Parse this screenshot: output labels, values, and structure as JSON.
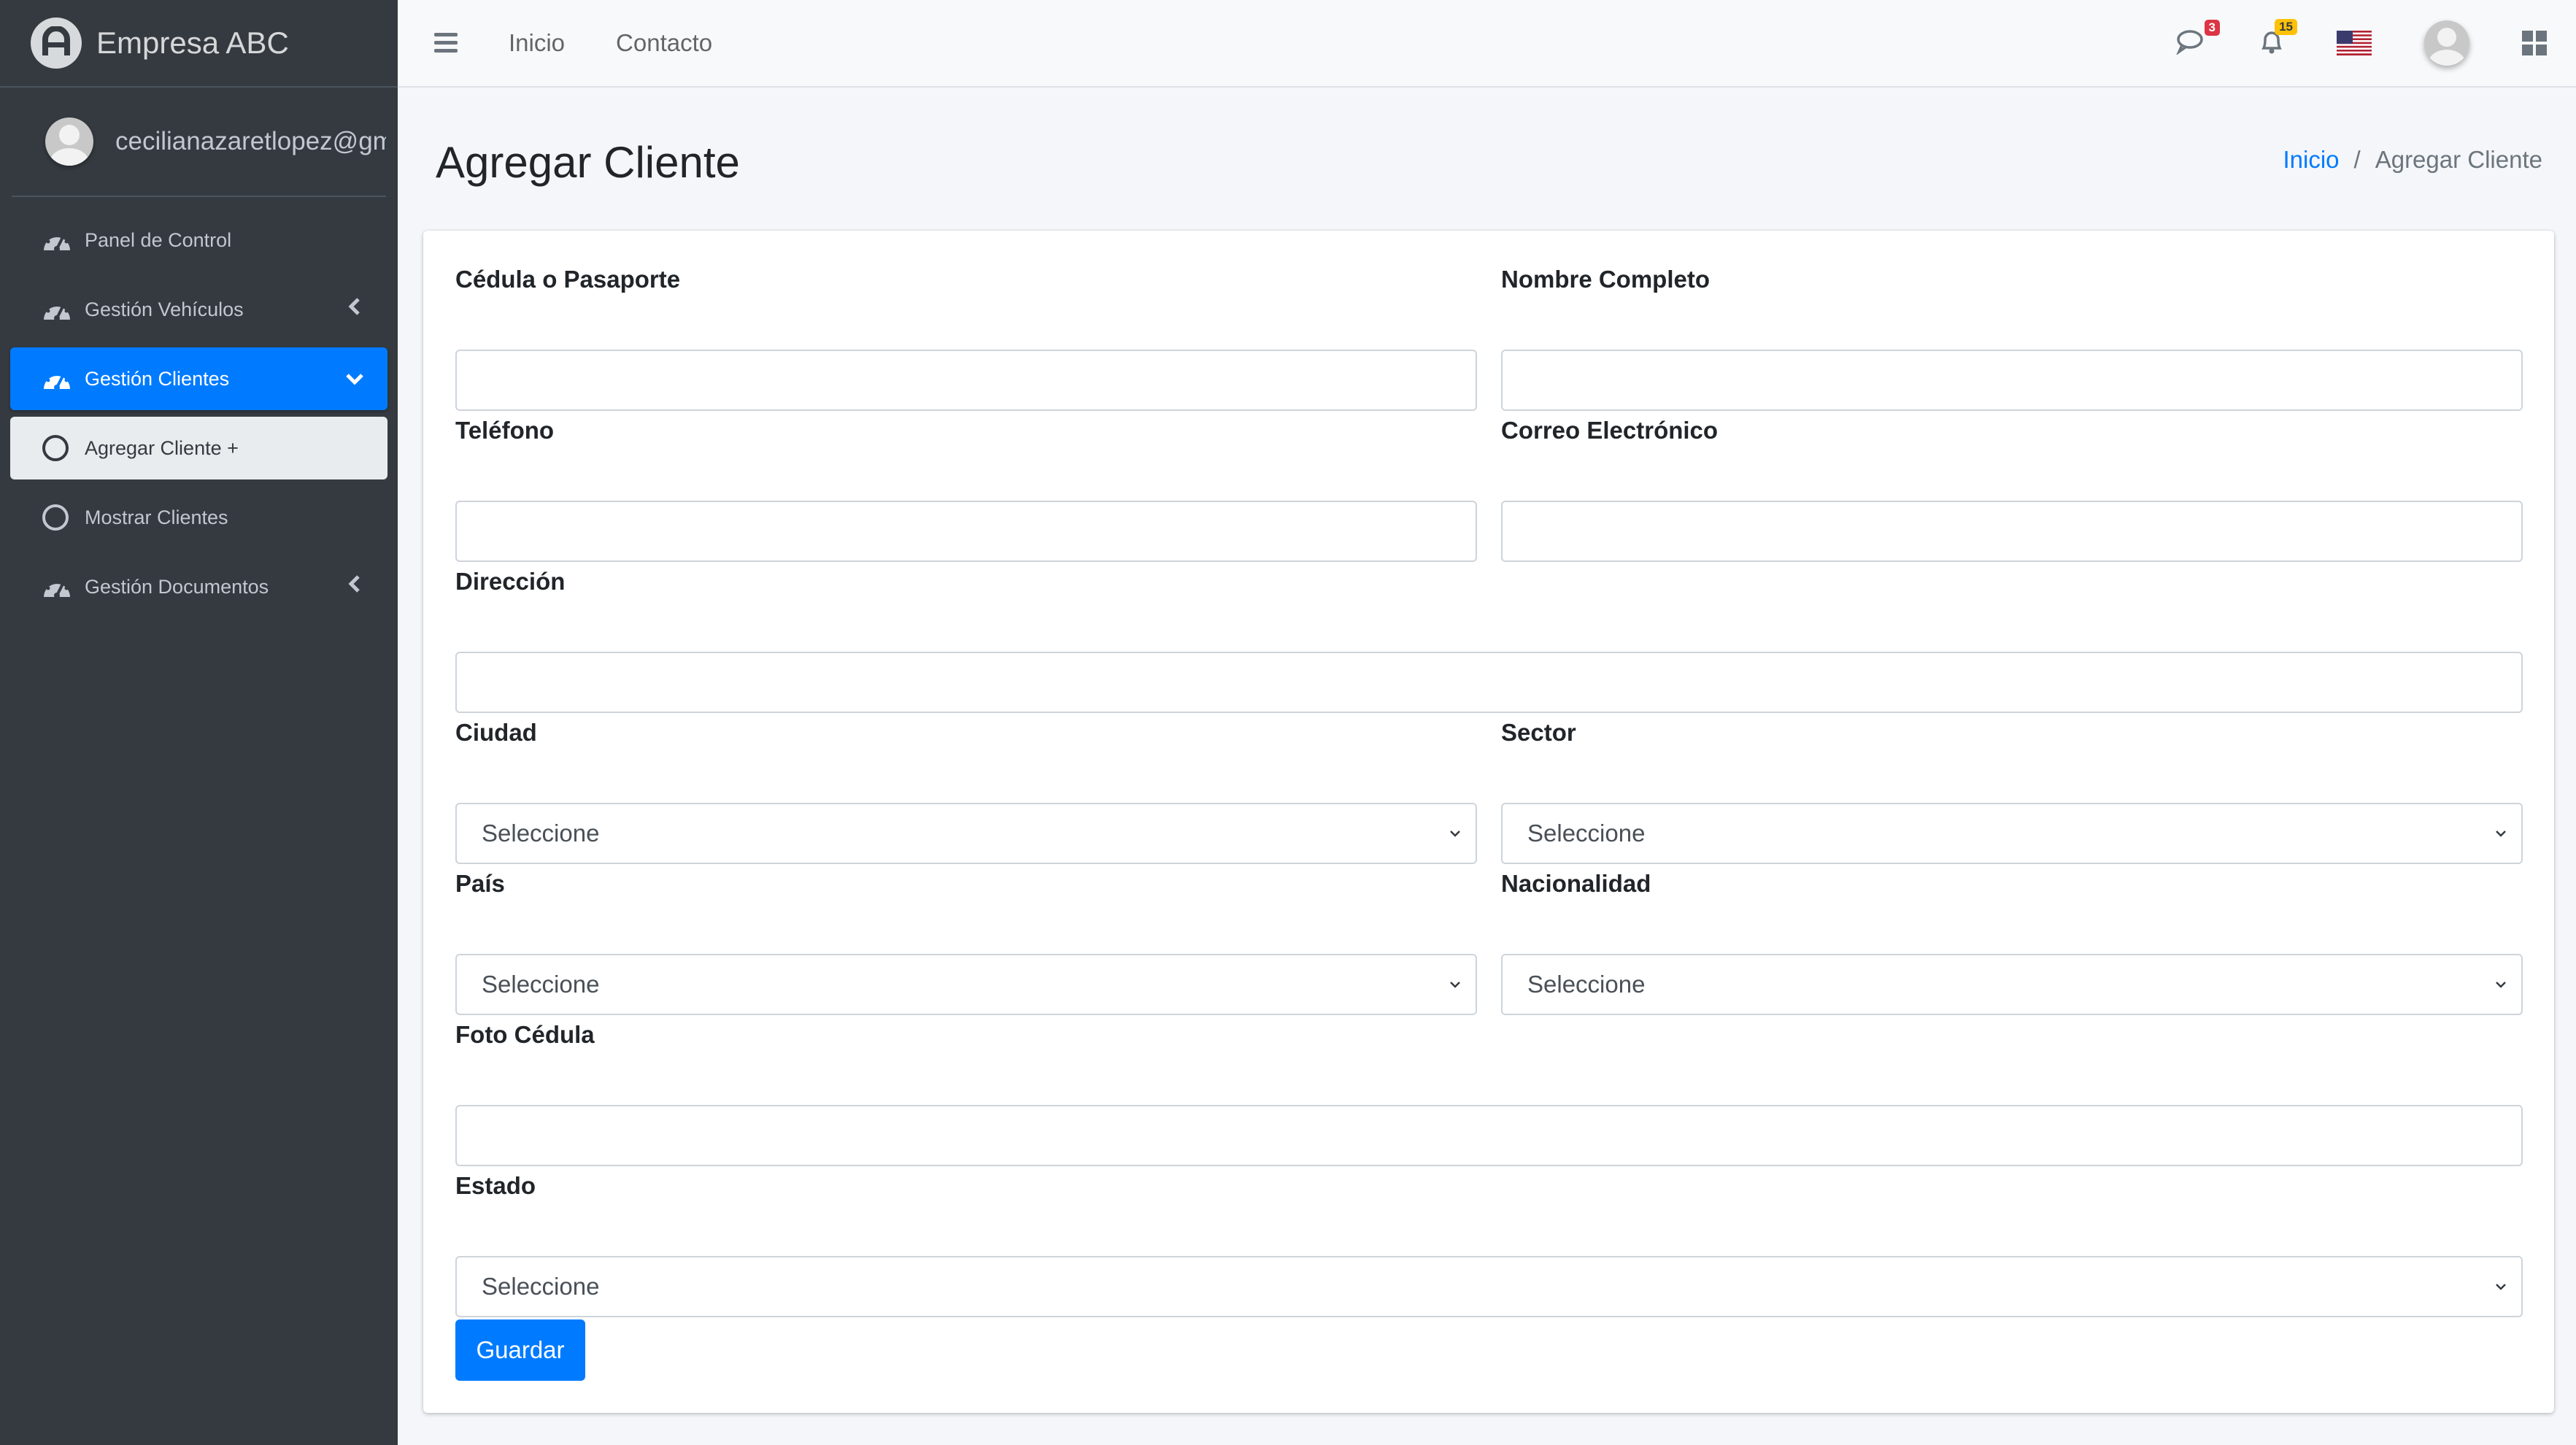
{
  "brand": {
    "name": "Empresa ABC"
  },
  "user": {
    "email": "cecilianazaretlopez@gmail"
  },
  "sidebar": {
    "items": [
      {
        "label": "Panel de Control",
        "icon": "tachometer-icon"
      },
      {
        "label": "Gestión Vehículos",
        "icon": "tachometer-icon",
        "arrow": "‹"
      },
      {
        "label": "Gestión Clientes",
        "icon": "tachometer-icon",
        "arrow": "⌄"
      },
      {
        "label": "Agregar Cliente +",
        "icon": "circle-icon"
      },
      {
        "label": "Mostrar Clientes",
        "icon": "circle-icon"
      },
      {
        "label": "Gestión Documentos",
        "icon": "tachometer-icon",
        "arrow": "‹"
      }
    ]
  },
  "topbar": {
    "links": [
      "Inicio",
      "Contacto"
    ],
    "messages_count": "3",
    "notifications_count": "15"
  },
  "header": {
    "title": "Agregar Cliente",
    "breadcrumb": {
      "home": "Inicio",
      "separator": "/",
      "current": "Agregar Cliente"
    }
  },
  "form": {
    "cedula_label": "Cédula o Pasaporte",
    "nombre_label": "Nombre Completo",
    "telefono_label": "Teléfono",
    "correo_label": "Correo Electrónico",
    "direccion_label": "Dirección",
    "ciudad_label": "Ciudad",
    "ciudad_value": "Seleccione",
    "sector_label": "Sector",
    "sector_value": "Seleccione",
    "pais_label": "País",
    "pais_value": "Seleccione",
    "nacionalidad_label": "Nacionalidad",
    "nacionalidad_value": "Seleccione",
    "foto_label": "Foto Cédula",
    "estado_label": "Estado",
    "estado_value": "Seleccione",
    "save_label": "Guardar"
  },
  "colors": {
    "sidebar_bg": "#343a40",
    "primary": "#007bff",
    "content_bg": "#f4f6f9",
    "badge_danger": "#dc3545",
    "badge_warning": "#ffc107"
  }
}
